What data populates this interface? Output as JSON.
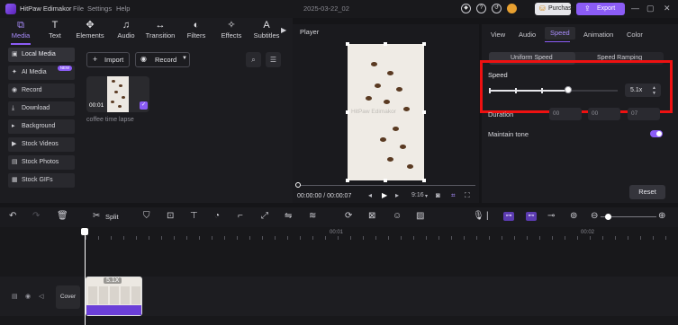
{
  "app": {
    "name": "HitPaw Edimakor",
    "menus": [
      "File",
      "Settings",
      "Help"
    ],
    "project_date": "2025-03-22_02",
    "purchase": "Purchase",
    "export": "Export"
  },
  "toolbar": {
    "items": [
      {
        "label": "Media",
        "icon": "media-icon"
      },
      {
        "label": "Text",
        "icon": "text-icon"
      },
      {
        "label": "Elements",
        "icon": "elements-icon"
      },
      {
        "label": "Audio",
        "icon": "audio-icon"
      },
      {
        "label": "Transition",
        "icon": "transition-icon"
      },
      {
        "label": "Filters",
        "icon": "filters-icon"
      },
      {
        "label": "Effects",
        "icon": "effects-icon"
      },
      {
        "label": "Subtitles",
        "icon": "subtitles-icon"
      }
    ],
    "active": "Media"
  },
  "sidebar": {
    "items": [
      {
        "label": "Local Media"
      },
      {
        "label": "AI Media",
        "badge": "NEW"
      },
      {
        "label": "Record"
      },
      {
        "label": "Download"
      },
      {
        "label": "Background"
      },
      {
        "label": "Stock Videos"
      },
      {
        "label": "Stock Photos"
      },
      {
        "label": "Stock GIFs"
      }
    ]
  },
  "media": {
    "import_label": "Import",
    "record_label": "Record",
    "clip": {
      "duration": "00:01",
      "name": "coffee time lapse"
    }
  },
  "player": {
    "title": "Player",
    "watermark": "HitPaw Edimakor",
    "timecode": "00:00:00 / 00:00:07",
    "aspect": "9:16"
  },
  "right_panel": {
    "tabs": [
      "View",
      "Audio",
      "Speed",
      "Animation",
      "Color"
    ],
    "active_tab": "Speed",
    "segments": [
      "Uniform Speed",
      "Speed Ramping"
    ],
    "speed_label": "Speed",
    "speed_value": "5.1x",
    "speed_fraction": 0.72,
    "duration_label": "Duration",
    "duration_fields": [
      "00",
      "00",
      "07"
    ],
    "maintain_tone_label": "Maintain tone",
    "maintain_tone_on": true,
    "reset_label": "Reset"
  },
  "edit_toolbar": {
    "split_label": "Split"
  },
  "timeline": {
    "ruler": [
      "00:01",
      "00:02"
    ],
    "cover_label": "Cover",
    "clip_speed": "5.1X"
  },
  "colors": {
    "accent": "#8b5cf6",
    "highlight_box": "#ee1111"
  }
}
